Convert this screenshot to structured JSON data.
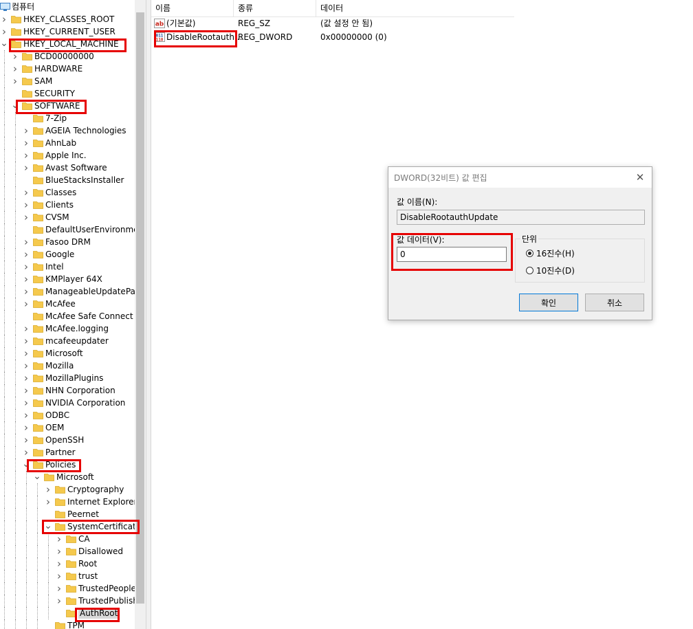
{
  "tree": {
    "rows": [
      {
        "label": "컴퓨터",
        "indent": -1,
        "expander": "",
        "icon": "computer"
      },
      {
        "label": "HKEY_CLASSES_ROOT",
        "indent": 0,
        "expander": ">"
      },
      {
        "label": "HKEY_CURRENT_USER",
        "indent": 0,
        "expander": ">"
      },
      {
        "label": "HKEY_LOCAL_MACHINE",
        "indent": 0,
        "expander": "v"
      },
      {
        "label": "BCD00000000",
        "indent": 1,
        "expander": ">"
      },
      {
        "label": "HARDWARE",
        "indent": 1,
        "expander": ">"
      },
      {
        "label": "SAM",
        "indent": 1,
        "expander": ">"
      },
      {
        "label": "SECURITY",
        "indent": 1,
        "expander": ""
      },
      {
        "label": "SOFTWARE",
        "indent": 1,
        "expander": "v"
      },
      {
        "label": "7-Zip",
        "indent": 2,
        "expander": ""
      },
      {
        "label": "AGEIA Technologies",
        "indent": 2,
        "expander": ">"
      },
      {
        "label": "AhnLab",
        "indent": 2,
        "expander": ">"
      },
      {
        "label": "Apple Inc.",
        "indent": 2,
        "expander": ">"
      },
      {
        "label": "Avast Software",
        "indent": 2,
        "expander": ">"
      },
      {
        "label": "BlueStacksInstaller",
        "indent": 2,
        "expander": ""
      },
      {
        "label": "Classes",
        "indent": 2,
        "expander": ">"
      },
      {
        "label": "Clients",
        "indent": 2,
        "expander": ">"
      },
      {
        "label": "CVSM",
        "indent": 2,
        "expander": ">"
      },
      {
        "label": "DefaultUserEnvironment",
        "indent": 2,
        "expander": ""
      },
      {
        "label": "Fasoo DRM",
        "indent": 2,
        "expander": ">"
      },
      {
        "label": "Google",
        "indent": 2,
        "expander": ">"
      },
      {
        "label": "Intel",
        "indent": 2,
        "expander": ">"
      },
      {
        "label": "KMPlayer 64X",
        "indent": 2,
        "expander": ">"
      },
      {
        "label": "ManageableUpdatePacka",
        "indent": 2,
        "expander": ">"
      },
      {
        "label": "McAfee",
        "indent": 2,
        "expander": ">"
      },
      {
        "label": "McAfee Safe Connect",
        "indent": 2,
        "expander": ""
      },
      {
        "label": "McAfee.logging",
        "indent": 2,
        "expander": ">"
      },
      {
        "label": "mcafeeupdater",
        "indent": 2,
        "expander": ">"
      },
      {
        "label": "Microsoft",
        "indent": 2,
        "expander": ">"
      },
      {
        "label": "Mozilla",
        "indent": 2,
        "expander": ">"
      },
      {
        "label": "MozillaPlugins",
        "indent": 2,
        "expander": ">"
      },
      {
        "label": "NHN Corporation",
        "indent": 2,
        "expander": ">"
      },
      {
        "label": "NVIDIA Corporation",
        "indent": 2,
        "expander": ">"
      },
      {
        "label": "ODBC",
        "indent": 2,
        "expander": ">"
      },
      {
        "label": "OEM",
        "indent": 2,
        "expander": ">"
      },
      {
        "label": "OpenSSH",
        "indent": 2,
        "expander": ">"
      },
      {
        "label": "Partner",
        "indent": 2,
        "expander": ">"
      },
      {
        "label": "Policies",
        "indent": 2,
        "expander": "v"
      },
      {
        "label": "Microsoft",
        "indent": 3,
        "expander": "v"
      },
      {
        "label": "Cryptography",
        "indent": 4,
        "expander": ">"
      },
      {
        "label": "Internet Explorer",
        "indent": 4,
        "expander": ">"
      },
      {
        "label": "Peernet",
        "indent": 4,
        "expander": ""
      },
      {
        "label": "SystemCertificates",
        "indent": 4,
        "expander": "v"
      },
      {
        "label": "CA",
        "indent": 5,
        "expander": ">"
      },
      {
        "label": "Disallowed",
        "indent": 5,
        "expander": ">"
      },
      {
        "label": "Root",
        "indent": 5,
        "expander": ">"
      },
      {
        "label": "trust",
        "indent": 5,
        "expander": ">"
      },
      {
        "label": "TrustedPeople",
        "indent": 5,
        "expander": ">"
      },
      {
        "label": "TrustedPublishe",
        "indent": 5,
        "expander": ">"
      },
      {
        "label": "AuthRoot",
        "indent": 5,
        "expander": "",
        "selected": true
      },
      {
        "label": "TPM",
        "indent": 4,
        "expander": ""
      }
    ]
  },
  "list": {
    "columns": {
      "name": "이름",
      "type": "종류",
      "data": "데이터"
    },
    "rows": [
      {
        "name": "(기본값)",
        "type": "REG_SZ",
        "data": "(값 설정 안 됨)",
        "icon": "string-value-icon"
      },
      {
        "name": "DisableRootauth...",
        "type": "REG_DWORD",
        "data": "0x00000000 (0)",
        "icon": "dword-value-icon"
      }
    ]
  },
  "dialog": {
    "title": "DWORD(32비트) 값 편집",
    "name_label": "값 이름(N):",
    "name_value": "DisableRootauthUpdate",
    "data_label": "값 데이터(V):",
    "data_value": "0",
    "base_label": "단위",
    "base_hex": "16진수(H)",
    "base_dec": "10진수(D)",
    "base_selected": "hex",
    "ok": "확인",
    "cancel": "취소"
  },
  "colors": {
    "highlight": "#e60000",
    "folder": "#f5c94d",
    "accent": "#0078d7"
  }
}
